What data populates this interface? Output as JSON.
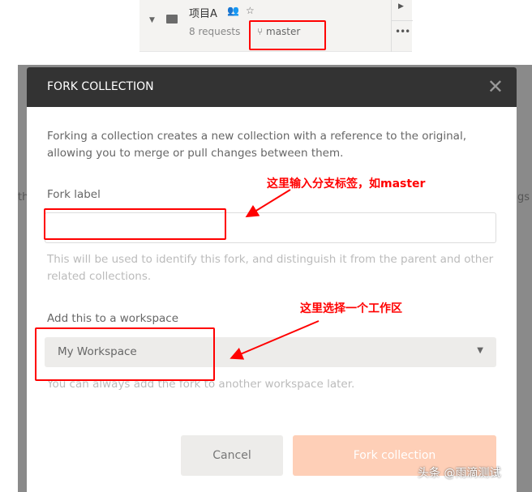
{
  "collection": {
    "name": "项目A",
    "requests": "8 requests",
    "branch": "master",
    "icons": [
      "caret-down-icon",
      "folder-icon",
      "team-icon",
      "star-icon",
      "branch-icon",
      "play-icon",
      "more-icon"
    ]
  },
  "dialog": {
    "title": "FORK COLLECTION",
    "description": "Forking a collection creates a new collection with a reference to the original, allowing you to merge or pull changes between them.",
    "fork_label": "Fork label",
    "fork_label_value": "",
    "fork_label_help": "This will be used to identify this fork, and distinguish it from the parent and other related collections.",
    "workspace_label": "Add this to a workspace",
    "workspace_value": "My Workspace",
    "workspace_help": "You can always add the fork to another workspace later.",
    "cancel": "Cancel",
    "fork_button": "Fork collection"
  },
  "background": {
    "left_text": "th",
    "right_text": "gs"
  },
  "annotations": {
    "fork_label_note": "这里输入分支标签，如master",
    "workspace_note": "这里选择一个工作区",
    "color": "#ff0000"
  },
  "watermark": "头条 @雨滴测试"
}
